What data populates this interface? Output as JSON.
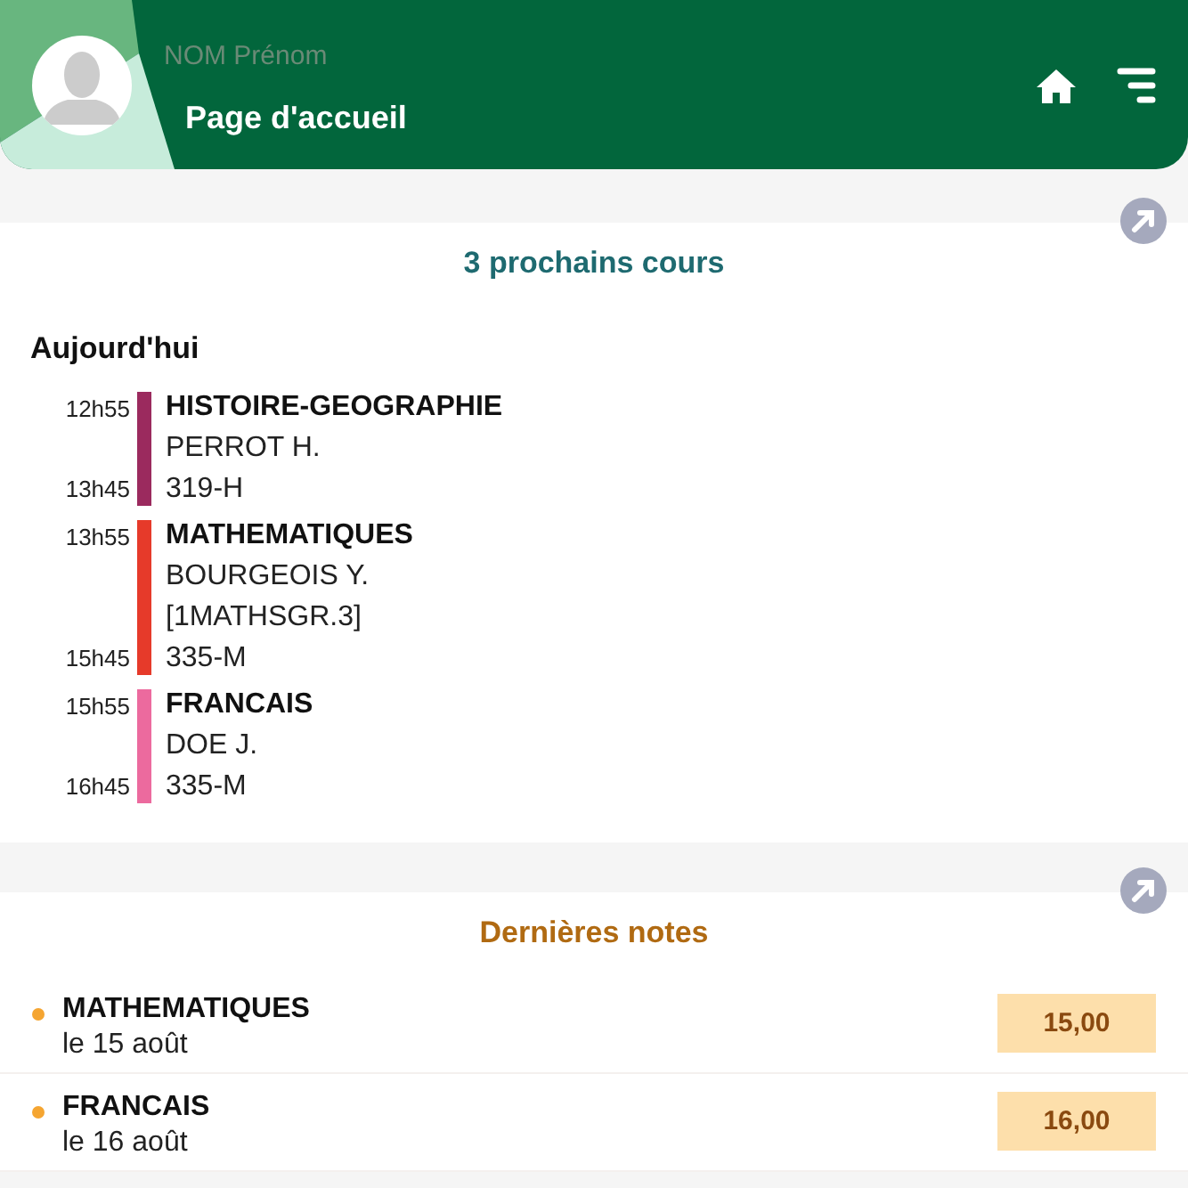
{
  "header": {
    "user_name": "NOM Prénom",
    "page_title": "Page d'accueil"
  },
  "next_courses": {
    "title": "3 prochains cours",
    "day": "Aujourd'hui",
    "courses": [
      {
        "start": "12h55",
        "end": "13h45",
        "color": "#9b2a5e",
        "subject": "HISTOIRE-GEOGRAPHIE",
        "details": [
          "PERROT H.",
          "319-H"
        ]
      },
      {
        "start": "13h55",
        "end": "15h45",
        "color": "#e63a2a",
        "subject": "MATHEMATIQUES",
        "details": [
          "BOURGEOIS Y.",
          "[1MATHSGR.3]",
          "335-M"
        ]
      },
      {
        "start": "15h55",
        "end": "16h45",
        "color": "#ec6a9e",
        "subject": "FRANCAIS",
        "details": [
          "DOE J.",
          "335-M"
        ]
      }
    ]
  },
  "last_grades": {
    "title": "Dernières notes",
    "grades": [
      {
        "subject": "MATHEMATIQUES",
        "date": "le 15 août",
        "grade": "15,00"
      },
      {
        "subject": "FRANCAIS",
        "date": "le 16 août",
        "grade": "16,00"
      }
    ]
  }
}
